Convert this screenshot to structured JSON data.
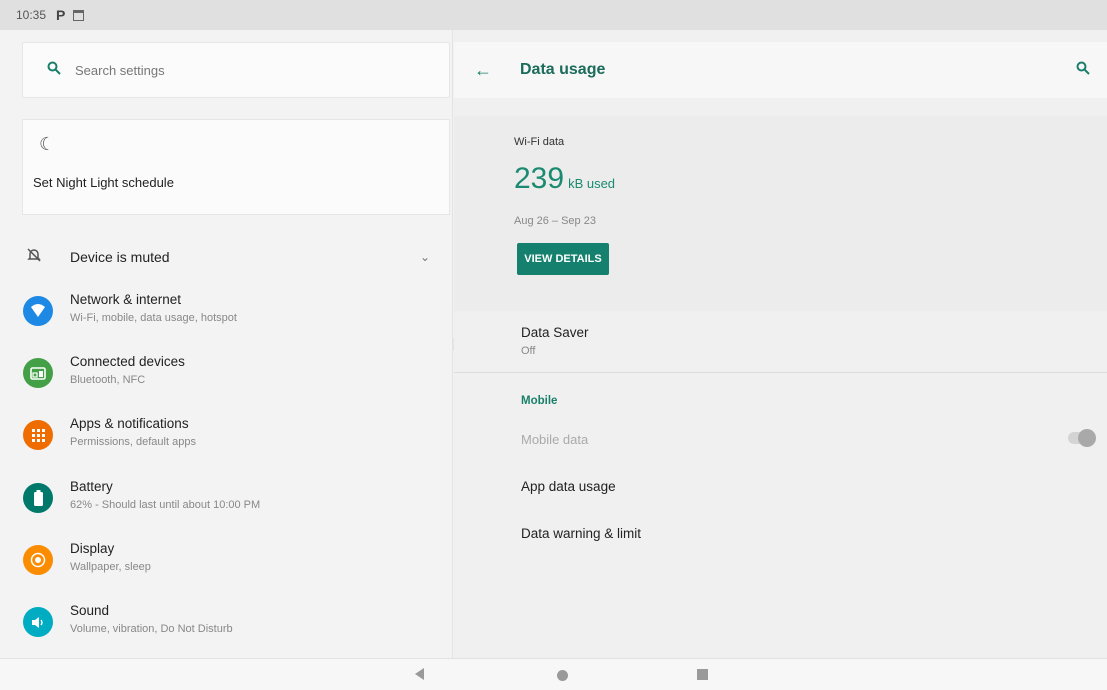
{
  "status_bar": {
    "time": "10:35",
    "app_icon": "P"
  },
  "search": {
    "placeholder": "Search settings"
  },
  "night_light": {
    "label": "Set Night Light schedule"
  },
  "device_muted": {
    "label": "Device is muted"
  },
  "menu": [
    {
      "title": "Network & internet",
      "subtitle": "Wi-Fi, mobile, data usage, hotspot",
      "icon": "wifi-icon",
      "color": "#1e88e5"
    },
    {
      "title": "Connected devices",
      "subtitle": "Bluetooth, NFC",
      "icon": "devices-icon",
      "color": "#43a047"
    },
    {
      "title": "Apps & notifications",
      "subtitle": "Permissions, default apps",
      "icon": "apps-grid-icon",
      "color": "#ef6c00"
    },
    {
      "title": "Battery",
      "subtitle": "62% - Should last until about 10:00 PM",
      "icon": "battery-icon",
      "color": "#00796b"
    },
    {
      "title": "Display",
      "subtitle": "Wallpaper, sleep",
      "icon": "brightness-icon",
      "color": "#fb8c00"
    },
    {
      "title": "Sound",
      "subtitle": "Volume, vibration, Do Not Disturb",
      "icon": "volume-icon",
      "color": "#00acc1"
    }
  ],
  "detail": {
    "title": "Data usage",
    "wifi_caption": "Wi-Fi data",
    "amount": "239",
    "unit": "kB used",
    "range": "Aug 26 – Sep 23",
    "view_details": "VIEW DETAILS",
    "data_saver_title": "Data Saver",
    "data_saver_status": "Off",
    "mobile_header": "Mobile",
    "mobile_data": "Mobile data",
    "mobile_data_enabled": false,
    "app_data_usage": "App data usage",
    "data_warning": "Data warning & limit"
  },
  "colors": {
    "accent": "#1a7f6a",
    "button": "#15806d"
  }
}
